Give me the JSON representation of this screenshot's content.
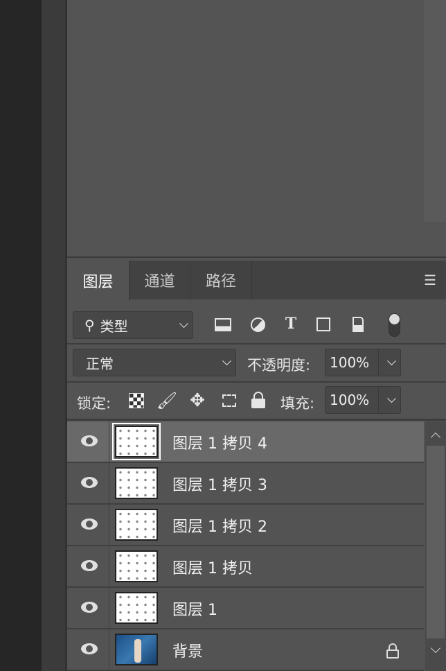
{
  "tabs": [
    {
      "label": "图层",
      "active": true
    },
    {
      "label": "通道"
    },
    {
      "label": "路径"
    }
  ],
  "menu_icon": "hamburger-menu-icon",
  "filter": {
    "search_icon": "search-icon",
    "value": "类型",
    "icons": [
      "image-filter-icon",
      "adjustment-filter-icon",
      "text-filter-icon",
      "shape-filter-icon",
      "smart-object-filter-icon",
      "filter-toggle-icon"
    ]
  },
  "blend": {
    "mode": "正常",
    "opacity_label": "不透明度:",
    "opacity": "100%"
  },
  "lock": {
    "label": "锁定:",
    "icons": [
      "lock-transparent-icon",
      "lock-pixels-icon",
      "lock-position-icon",
      "lock-artboard-icon",
      "lock-all-icon"
    ],
    "fill_label": "填充:",
    "fill": "100%"
  },
  "layers": [
    {
      "name": "图层 1 拷贝 4",
      "visible": true,
      "selected": true
    },
    {
      "name": "图层 1 拷贝 3",
      "visible": true
    },
    {
      "name": "图层 1 拷贝 2",
      "visible": true
    },
    {
      "name": "图层 1 拷贝",
      "visible": true
    },
    {
      "name": "图层 1",
      "visible": true
    },
    {
      "name": "背景",
      "visible": true,
      "locked": true
    }
  ],
  "colors": {
    "panel": "#535353",
    "selected_row": "#696969",
    "tabbar": "#424242"
  }
}
